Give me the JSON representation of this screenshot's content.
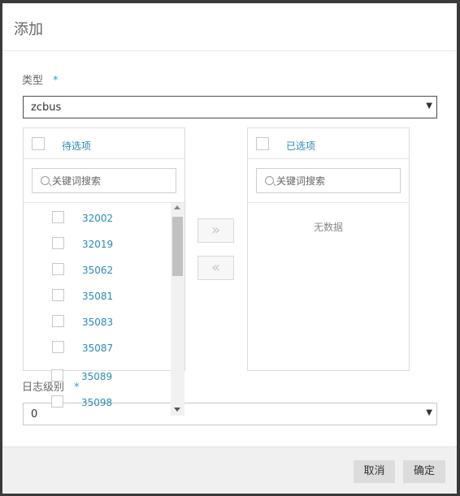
{
  "dialog": {
    "title": "添加"
  },
  "type_field": {
    "label": "类型",
    "required_mark": "*",
    "value": "zcbus",
    "caret": "▼"
  },
  "transfer": {
    "left": {
      "title": "待选项",
      "search_placeholder": "关键词搜索",
      "items": [
        "32002",
        "32019",
        "35062",
        "35081",
        "35083",
        "35087",
        "35089",
        "35098"
      ]
    },
    "right": {
      "title": "已选项",
      "search_placeholder": "关键词搜索",
      "empty_text": "无数据"
    },
    "to_right_label": "»",
    "to_left_label": "«"
  },
  "log_field": {
    "label": "日志级别",
    "required_mark": "*",
    "value": "0",
    "caret": "▼"
  },
  "footer": {
    "cancel_label": "取消",
    "ok_label": "确定"
  }
}
